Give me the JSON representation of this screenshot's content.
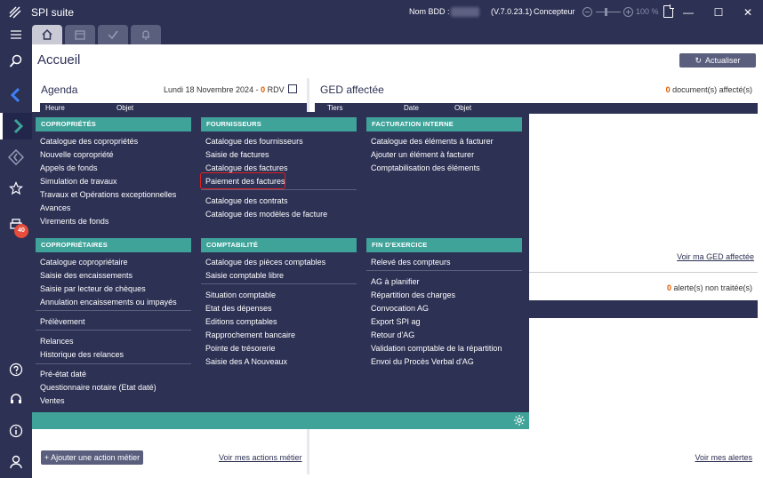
{
  "window": {
    "title": "SPI suite",
    "db_label": "Nom BDD :",
    "version": "(V.7.0.23.1)",
    "role": "Concepteur",
    "zoom": "100 %",
    "minimize": "—",
    "maximize": "☐",
    "close": "✕"
  },
  "page": {
    "title": "Accueil",
    "refresh_label": "Actualiser"
  },
  "agenda": {
    "title": "Agenda",
    "date": "Lundi 18 Novembre 2024 - ",
    "count": "0",
    "count_suffix": " RDV",
    "col1": "Heure",
    "col2": "Objet"
  },
  "ged": {
    "title": "GED affectée",
    "count": "0",
    "count_suffix": " document(s) affecté(s)",
    "col1": "Tiers",
    "col2": "Date",
    "col3": "Objet",
    "link": "Voir ma GED affectée"
  },
  "alerts": {
    "count": "0",
    "count_suffix": " alerte(s) non traitée(s)",
    "link": "Voir mes alertes"
  },
  "footer_actions": {
    "add_label": "+ Ajouter une action métier",
    "link": "Voir mes actions métier"
  },
  "rail": {
    "badge": "40"
  },
  "menu": {
    "copro": {
      "header": "COPROPRIÉTÉS",
      "items": [
        "Catalogue des copropriétés",
        "Nouvelle copropriété",
        "Appels de fonds",
        "Simulation de travaux",
        "Travaux et Opérations exceptionnelles",
        "Avances",
        "Virements de fonds"
      ]
    },
    "fourn": {
      "header": "FOURNISSEURS",
      "items": [
        "Catalogue des fournisseurs",
        "Saisie de factures",
        "Catalogue des factures",
        "Paiement des factures"
      ],
      "items2": [
        "Catalogue des contrats",
        "Catalogue des modèles de facture"
      ]
    },
    "factint": {
      "header": "FACTURATION INTERNE",
      "items": [
        "Catalogue des éléments à facturer",
        "Ajouter un élément à facturer",
        "Comptabilisation des éléments"
      ]
    },
    "coprietaires": {
      "header": "COPROPRIÉTAIRES",
      "items": [
        "Catalogue copropriétaire",
        "Saisie des encaissements",
        "Saisie par lecteur de chèques",
        "Annulation encaissements ou impayés"
      ],
      "items2": [
        "Prélèvement"
      ],
      "items3": [
        "Relances",
        "Historique des relances"
      ],
      "items4": [
        "Pré-état daté",
        "Questionnaire notaire (Etat daté)",
        "Ventes"
      ]
    },
    "compta": {
      "header": "COMPTABILITÉ",
      "items": [
        "Catalogue des pièces comptables",
        "Saisie comptable libre"
      ],
      "items2": [
        "Situation comptable",
        "Etat des dépenses",
        "Editions comptables",
        "Rapprochement bancaire",
        "Pointe de trésorerie",
        "Saisie des A Nouveaux"
      ]
    },
    "finexo": {
      "header": "FIN D'EXERCICE",
      "items": [
        "Relevé des compteurs"
      ],
      "items2": [
        "AG à planifier",
        "Répartition des charges",
        "Convocation AG",
        "Export SPI ag",
        "Retour d'AG",
        "Validation comptable de la répartition",
        "Envoi du Procès Verbal d'AG"
      ]
    }
  }
}
